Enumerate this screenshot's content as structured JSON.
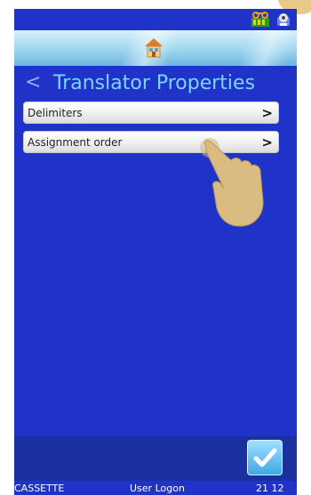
{
  "titlebar": {
    "back_label": "<",
    "title": "Translator Properties"
  },
  "menu": {
    "items": [
      {
        "label": "Delimiters",
        "chevron": ">"
      },
      {
        "label": "Assignment order",
        "chevron": ">"
      }
    ]
  },
  "footer": {
    "left": "CASSETTE",
    "center": "User Logon",
    "right": "21 12"
  },
  "icons": {
    "status_1": "cassette-icon",
    "status_2": "printer-icon",
    "home": "home-icon",
    "confirm": "checkmark-icon",
    "gesture": "tap-hand-icon"
  },
  "colors": {
    "background": "#1f33c8",
    "title": "#7fd3ff",
    "button_fill": "#f0f0f0",
    "footer_text": "#ffffff"
  }
}
